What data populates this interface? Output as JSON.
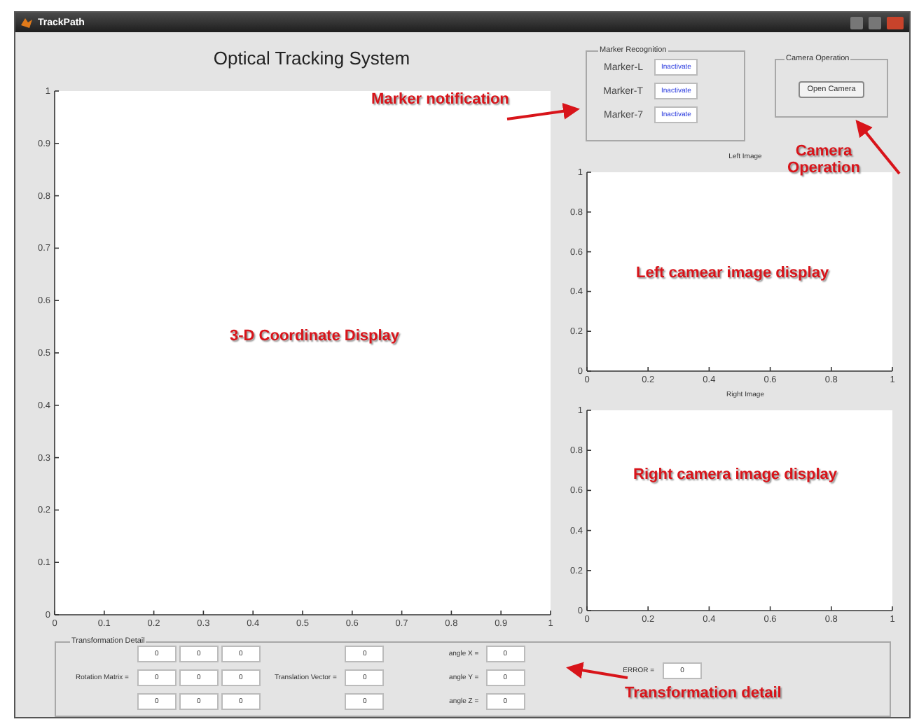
{
  "window": {
    "title": "TrackPath"
  },
  "main_title": "Optical Tracking System",
  "main_plot": {
    "chart_data": {
      "type": "line",
      "xlim": [
        0,
        1
      ],
      "ylim": [
        0,
        1
      ],
      "xticks": [
        0,
        0.1,
        0.2,
        0.3,
        0.4,
        0.5,
        0.6,
        0.7,
        0.8,
        0.9,
        1
      ],
      "yticks": [
        0,
        0.1,
        0.2,
        0.3,
        0.4,
        0.5,
        0.6,
        0.7,
        0.8,
        0.9,
        1
      ]
    }
  },
  "marker_recognition": {
    "title": "Marker Recognition",
    "markers": [
      {
        "label": "Marker-L",
        "status": "Inactivate"
      },
      {
        "label": "Marker-T",
        "status": "Inactivate"
      },
      {
        "label": "Marker-7",
        "status": "Inactivate"
      }
    ]
  },
  "camera_operation": {
    "title": "Camera Operation",
    "button": "Open Camera"
  },
  "left_image": {
    "chart_data": {
      "type": "line",
      "title": "Left Image",
      "xlim": [
        0,
        1
      ],
      "ylim": [
        0,
        1
      ],
      "xticks": [
        0,
        0.2,
        0.4,
        0.6,
        0.8,
        1
      ],
      "yticks": [
        0,
        0.2,
        0.4,
        0.6,
        0.8,
        1
      ]
    }
  },
  "right_image": {
    "chart_data": {
      "type": "line",
      "title": "Right Image",
      "xlim": [
        0,
        1
      ],
      "ylim": [
        0,
        1
      ],
      "xticks": [
        0,
        0.2,
        0.4,
        0.6,
        0.8,
        1
      ],
      "yticks": [
        0,
        0.2,
        0.4,
        0.6,
        0.8,
        1
      ]
    }
  },
  "transformation_detail": {
    "title": "Transformation Detail",
    "rotation_label": "Rotation Matrix =",
    "rotation_matrix": [
      [
        "0",
        "0",
        "0"
      ],
      [
        "0",
        "0",
        "0"
      ],
      [
        "0",
        "0",
        "0"
      ]
    ],
    "translation_label": "Translation Vector =",
    "translation_vector": [
      "0",
      "0",
      "0"
    ],
    "angles": [
      {
        "label": "angle X =",
        "value": "0"
      },
      {
        "label": "angle Y =",
        "value": "0"
      },
      {
        "label": "angle Z =",
        "value": "0"
      }
    ],
    "error_label": "ERROR =",
    "error_value": "0"
  },
  "annotations": [
    {
      "text": "Marker notification"
    },
    {
      "text": "Camera Operation"
    },
    {
      "text": "Left camear image display"
    },
    {
      "text": "3-D Coordinate Display"
    },
    {
      "text": "Right camera image display"
    },
    {
      "text": "Transformation detail"
    }
  ]
}
